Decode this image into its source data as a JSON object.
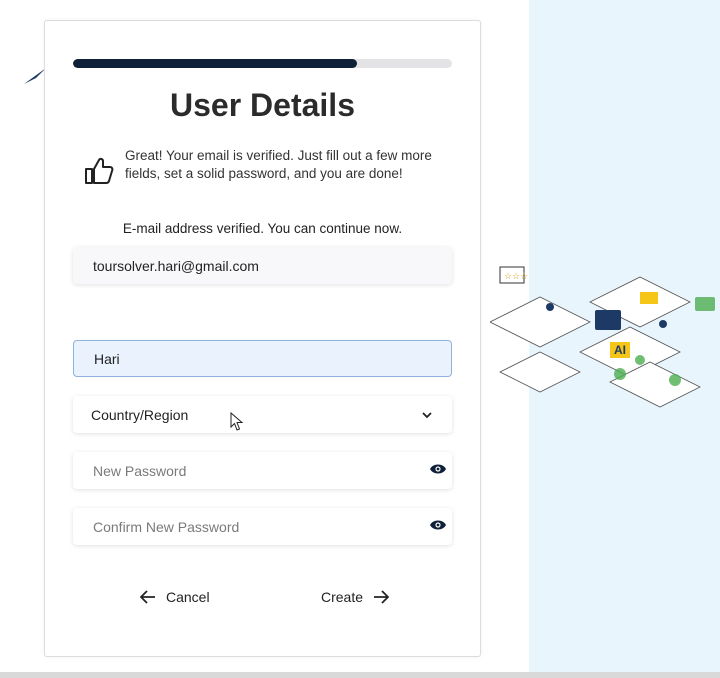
{
  "page": {
    "title": "User Details",
    "progress_fraction": 0.75,
    "intro_text": "Great! Your email is verified. Just fill out a few more fields, set a solid password, and you are done!",
    "verified_text": "E-mail address verified. You can continue now."
  },
  "form": {
    "email_value": "toursolver.hari@gmail.com",
    "name_value": "Hari",
    "country_placeholder": "Country/Region",
    "password_placeholder": "New Password",
    "confirm_password_placeholder": "Confirm New Password"
  },
  "actions": {
    "cancel_label": "Cancel",
    "create_label": "Create"
  },
  "icons": {
    "thumb": "thumbs-up-icon",
    "eye": "eye-icon",
    "chevron": "chevron-down-icon",
    "back": "arrow-left-icon",
    "forward": "arrow-right-icon"
  },
  "colors": {
    "accent": "#0f2039",
    "focused_field": "#e9f2fd",
    "right_panel": "#e8f5fd"
  }
}
